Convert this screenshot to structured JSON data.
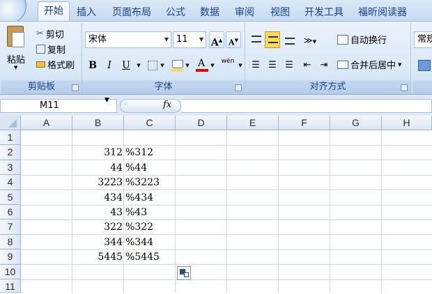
{
  "ribbon_tabs": [
    "开始",
    "插入",
    "页面布局",
    "公式",
    "数据",
    "审阅",
    "视图",
    "开发工具",
    "福昕阅读器"
  ],
  "clipboard": {
    "paste_label": "粘贴",
    "cut_label": "剪切",
    "copy_label": "复制",
    "format_painter_label": "格式刷",
    "group_label": "剪贴板"
  },
  "font": {
    "font_name": "宋体",
    "font_size": "11",
    "grow_label": "A",
    "shrink_label": "A",
    "bold": "B",
    "italic": "I",
    "underline": "U",
    "font_color_glyph": "A",
    "phonetic_glyph": "wén",
    "group_label": "字体"
  },
  "alignment": {
    "wrap_text_label": "自动换行",
    "merge_center_label": "合并后居中",
    "group_label": "对齐方式"
  },
  "number": {
    "format_label": "常规"
  },
  "formula_bar": {
    "name_box": "M11",
    "fx_label": "fx",
    "formula": ""
  },
  "columns": [
    "A",
    "B",
    "C",
    "D",
    "E",
    "F",
    "G",
    "H"
  ],
  "rows": [
    "1",
    "2",
    "3",
    "4",
    "5",
    "6",
    "7",
    "8",
    "9",
    "10",
    "11"
  ],
  "cells": [
    {
      "b": "",
      "c": ""
    },
    {
      "b": "312",
      "c": "%312"
    },
    {
      "b": "44",
      "c": "%44"
    },
    {
      "b": "3223",
      "c": "%3223"
    },
    {
      "b": "434",
      "c": "%434"
    },
    {
      "b": "43",
      "c": "%43"
    },
    {
      "b": "322",
      "c": "%322"
    },
    {
      "b": "344",
      "c": "%344"
    },
    {
      "b": "5445",
      "c": "%5445"
    },
    {
      "b": "",
      "c": ""
    },
    {
      "b": "",
      "c": ""
    }
  ],
  "colors": {
    "tab_text": "#15428b",
    "ribbon_bg": "#dfe9f5",
    "gridline": "#d0d7e5",
    "highlight": "#ffd866",
    "font_red": "#e00000"
  }
}
